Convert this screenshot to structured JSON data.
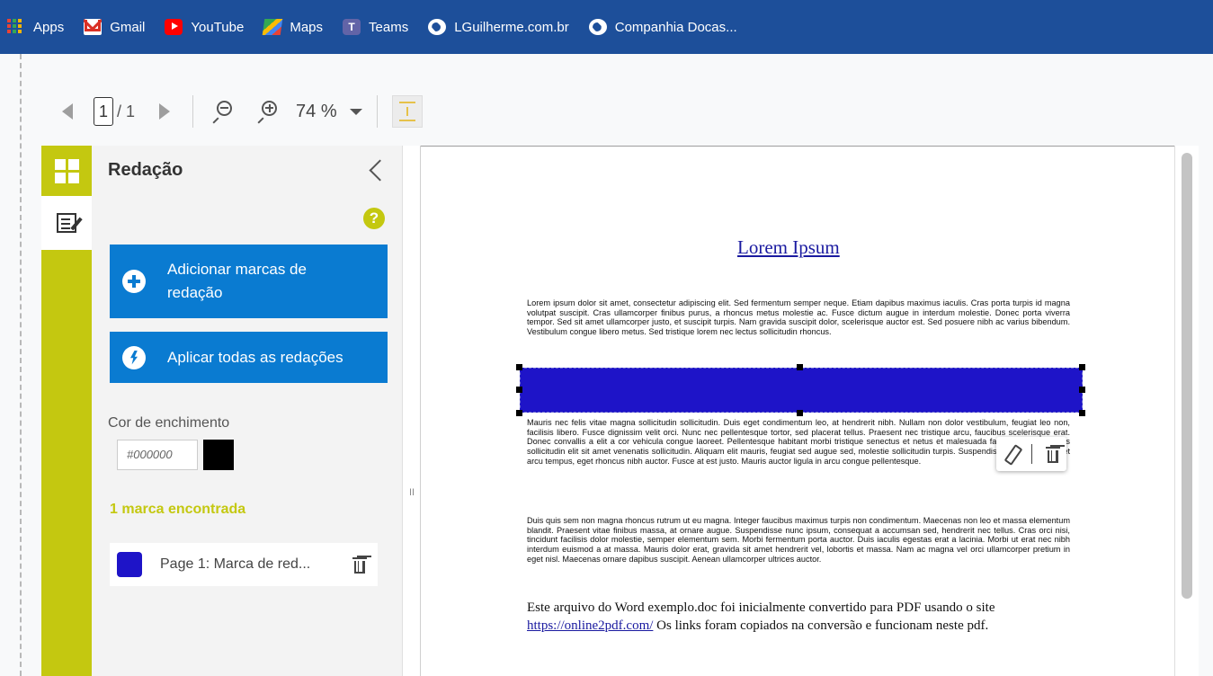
{
  "bookmarks": [
    {
      "label": "Apps",
      "icon": "apps-grid-icon"
    },
    {
      "label": "Gmail",
      "icon": "gmail-icon"
    },
    {
      "label": "YouTube",
      "icon": "youtube-icon"
    },
    {
      "label": "Maps",
      "icon": "maps-icon"
    },
    {
      "label": "Teams",
      "icon": "teams-icon"
    },
    {
      "label": "LGuilherme.com.br",
      "icon": "globe-icon"
    },
    {
      "label": "Companhia Docas...",
      "icon": "globe-icon"
    }
  ],
  "toolbar": {
    "page_current": "1",
    "page_total": "/ 1",
    "zoom": "74 %"
  },
  "panel": {
    "title": "Redação",
    "add_marks_label": "Adicionar marcas de redação",
    "apply_all_label": "Aplicar todas as redações",
    "fill_color_label": "Cor de enchimento",
    "fill_color_value": "#000000",
    "found_label": "1 marca encontrada",
    "marks": [
      {
        "label": "Page 1: Marca de red...",
        "color": "#1e14c8"
      }
    ]
  },
  "colors": {
    "accent": "#c4c810",
    "button_blue": "#0a7bd1",
    "redaction_fill": "#1e14c8",
    "bookmarks_bar": "#1d4f9a"
  },
  "document": {
    "title": "Lorem Ipsum",
    "para1": "Lorem ipsum dolor sit amet, consectetur adipiscing elit. Sed fermentum semper neque. Etiam dapibus maximus iaculis. Cras porta turpis id magna volutpat suscipit. Cras ullamcorper finibus purus, a rhoncus metus molestie ac. Fusce dictum augue in interdum molestie. Donec porta viverra tempor. Sed sit amet ullamcorper justo, et suscipit turpis. Nam gravida suscipit dolor, scelerisque auctor est. Sed posuere nibh ac varius bibendum. Vestibulum congue libero metus. Sed tristique lorem nec lectus sollicitudin rhoncus.",
    "para2": "Mauris nec felis vitae magna sollicitudin sollicitudin. Duis eget condimentum leo, at hendrerit nibh. Nullam non dolor vestibulum, feugiat leo non, facilisis libero. Fusce dignissim velit orci. Nunc nec pellentesque tortor, sed placerat tellus. Praesent nec tristique arcu, faucibus scelerisque erat. Donec convallis a elit a cor vehicula congue laoreet. Pellentesque habitant morbi tristique senectus et netus et malesuada fa egestas. Phasellus sollicitudin elit sit amet venenatis sollicitudin. Aliquam elit mauris, feugiat sed augue sed, molestie sollicitudin turpis. Suspendisse feugiat massa et arcu tempus, eget rhoncus nibh auctor. Fusce at est justo. Mauris auctor ligula in arcu congue pellentesque.",
    "para3": "Duis quis sem non magna rhoncus rutrum ut eu magna. Integer faucibus maximus turpis non condimentum. Maecenas non leo et massa elementum blandit. Praesent vitae finibus massa, at ornare augue. Suspendisse nunc ipsum, consequat a accumsan sed, hendrerit nec tellus. Cras orci nisi, tincidunt facilisis dolor molestie, semper elementum sem. Morbi fermentum porta auctor. Duis iaculis egestas erat a lacinia. Morbi ut erat nec nibh interdum euismod a at massa. Mauris dolor erat, gravida sit amet hendrerit vel, lobortis et massa. Nam ac magna vel orci ullamcorper pretium in eget nisl. Maecenas ornare dapibus suscipit. Aenean ullamcorper ultrices auctor.",
    "footer_before": "Este arquivo do Word exemplo.doc foi inicialmente convertido para PDF usando o site",
    "footer_link": "https://online2pdf.com/",
    "footer_after": " Os links foram copiados na conversão e funcionam neste pdf."
  },
  "splitter_glyph": "II"
}
